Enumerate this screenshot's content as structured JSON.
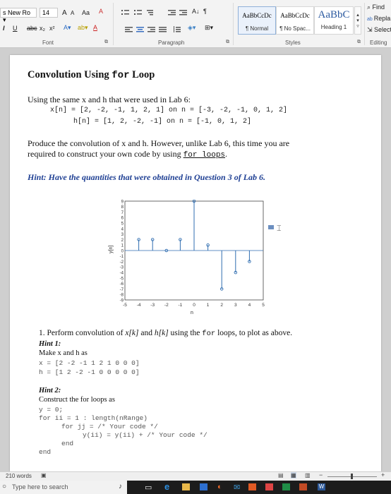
{
  "ribbon": {
    "font_name": "s New Ro",
    "font_size": "14",
    "grow_font": "A",
    "shrink_font": "A",
    "case": "Aa",
    "bold": "I",
    "underline": "U",
    "strike": "abc",
    "subscript": "x₂",
    "superscript": "x²",
    "font_color": "A",
    "paragraph_mark": "¶",
    "sort": "A↓",
    "styles": [
      {
        "sample": "AaBbCcDc",
        "label": "¶ Normal"
      },
      {
        "sample": "AaBbCcDc",
        "label": "¶ No Spac..."
      },
      {
        "sample": "AaBbC",
        "label": "Heading 1"
      }
    ],
    "find": "Find",
    "replace": "Repla",
    "select": "Select",
    "group_font": "Font",
    "group_paragraph": "Paragraph",
    "group_styles": "Styles",
    "group_editing": "Editing"
  },
  "doc": {
    "title_prefix": "Convolution Using ",
    "title_code": "for",
    "title_suffix": " Loop",
    "intro": "Using the same x and h that were used in Lab 6:",
    "x_line": "x[n] = [2, -2, -1, 1, 2, 1] on n = [-3, -2, -1, 0, 1, 2]",
    "h_line": "h[n] = [1, 2, -2, -1] on n = [-1, 0, 1, 2]",
    "task_line1": "Produce the convolution of x and h. However, unlike Lab 6, this time you are",
    "task_line2_a": "required to construct your own code by using ",
    "task_line2_code": "for loops",
    "task_line2_b": ".",
    "hint_main": "Hint: Have the quantities that were obtained in Question 3 of Lab 6.",
    "q1_a": "1. Perform convolution of ",
    "q1_b": "x[k]",
    "q1_c": " and ",
    "q1_d": "h[k]",
    "q1_e": " using the ",
    "q1_code": "for",
    "q1_f": " loops, to plot as above.",
    "hint1_label": "Hint 1:",
    "hint1_text": "Make x and h as",
    "x_arr": "x = [2 -2 -1 1 2 1 0 0 0]",
    "h_arr": "h = [1 2 -2 -1 0 0 0 0 0]",
    "hint2_label": "Hint 2:",
    "hint2_text": "Construct the for loops as",
    "code_line1": "y = 0;",
    "code_line2": "for ii = 1 : length(nRange)",
    "code_line3": "for jj = /* Your code */",
    "code_line4": "y(ii) = y(ii) + /* Your code */",
    "code_line5": "end",
    "code_line6": "end"
  },
  "chart_data": {
    "type": "stem",
    "x": [
      -4,
      -3,
      -2,
      -1,
      0,
      1,
      2,
      3,
      4
    ],
    "values": [
      2,
      2,
      0,
      2,
      9,
      1,
      -7,
      -4,
      -2
    ],
    "ylabel": "y[n]",
    "xlabel": "n",
    "xlim": [
      -5,
      5
    ],
    "ylim": [
      -9,
      9
    ],
    "xticks": [
      "-5",
      "-4",
      "-3",
      "-2",
      "-1",
      "0",
      "1",
      "2",
      "3",
      "4",
      "5"
    ],
    "yticks": [
      "9",
      "8",
      "7",
      "6",
      "5",
      "4",
      "3",
      "2",
      "1",
      "0",
      "-1",
      "-2",
      "-3",
      "-4",
      "-5",
      "-6",
      "-7",
      "-8",
      "-9"
    ],
    "grid": false
  },
  "statusbar": {
    "words": "210 words"
  },
  "taskbar": {
    "search_placeholder": "Type here to search"
  },
  "colors": {
    "hint": "#1e3f93",
    "stem": "#2f6db0",
    "page": "#ffffff",
    "taskbar": "#1c1c1c"
  }
}
